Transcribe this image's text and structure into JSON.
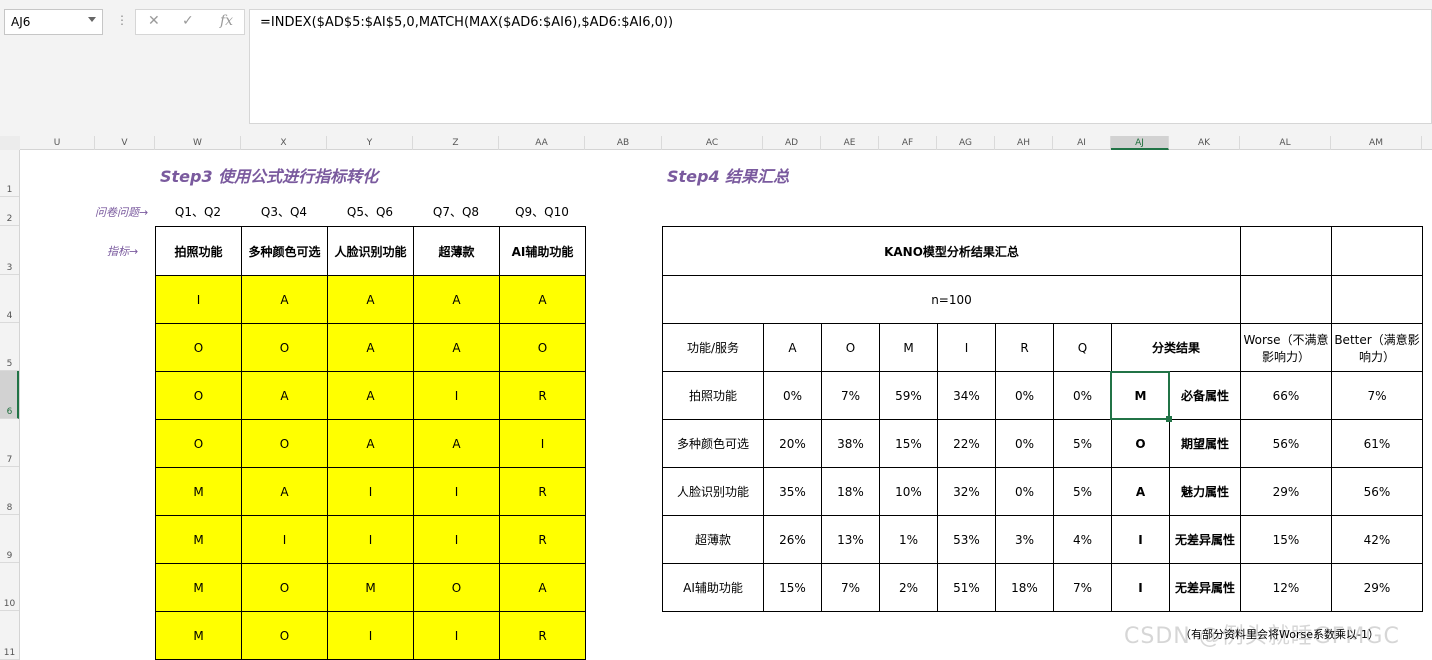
{
  "formula_bar": {
    "name_box": "AJ6",
    "formula": "=INDEX($AD$5:$AI$5,0,MATCH(MAX($AD6:$AI6),$AD6:$AI6,0))"
  },
  "columns": [
    "U",
    "V",
    "W",
    "X",
    "Y",
    "Z",
    "AA",
    "AB",
    "AC",
    "AD",
    "AE",
    "AF",
    "AG",
    "AH",
    "AI",
    "AJ",
    "AK",
    "AL",
    "AM"
  ],
  "rows": [
    "1",
    "2",
    "3",
    "4",
    "5",
    "6",
    "7",
    "8",
    "9",
    "10",
    "11"
  ],
  "step3": {
    "title": "Step3 使用公式进行指标转化",
    "question_label": "问卷问题→",
    "indicator_label": "指标→",
    "questions": [
      "Q1、Q2",
      "Q3、Q4",
      "Q5、Q6",
      "Q7、Q8",
      "Q9、Q10"
    ],
    "headers": [
      "拍照功能",
      "多种颜色可选",
      "人脸识别功能",
      "超薄款",
      "AI辅助功能"
    ],
    "rows": [
      [
        "I",
        "A",
        "A",
        "A",
        "A"
      ],
      [
        "O",
        "O",
        "A",
        "A",
        "O"
      ],
      [
        "O",
        "A",
        "A",
        "I",
        "R"
      ],
      [
        "O",
        "O",
        "A",
        "A",
        "I"
      ],
      [
        "M",
        "A",
        "I",
        "I",
        "R"
      ],
      [
        "M",
        "I",
        "I",
        "I",
        "R"
      ],
      [
        "M",
        "O",
        "M",
        "O",
        "A"
      ],
      [
        "M",
        "O",
        "I",
        "I",
        "R"
      ]
    ]
  },
  "step4": {
    "title": "Step4 结果汇总",
    "summary_title": "KANO模型分析结果汇总",
    "n_label": "n=100",
    "headers": {
      "feature": "功能/服务",
      "A": "A",
      "O": "O",
      "M": "M",
      "I": "I",
      "R": "R",
      "Q": "Q",
      "result": "分类结果",
      "worse": "Worse（不满意影响力）",
      "better": "Better（满意影响力）"
    },
    "rows": [
      {
        "feature": "拍照功能",
        "A": "0%",
        "O": "7%",
        "M": "59%",
        "I": "34%",
        "R": "0%",
        "Q": "0%",
        "code": "M",
        "attr": "必备属性",
        "worse": "66%",
        "better": "7%"
      },
      {
        "feature": "多种颜色可选",
        "A": "20%",
        "O": "38%",
        "M": "15%",
        "I": "22%",
        "R": "0%",
        "Q": "5%",
        "code": "O",
        "attr": "期望属性",
        "worse": "56%",
        "better": "61%"
      },
      {
        "feature": "人脸识别功能",
        "A": "35%",
        "O": "18%",
        "M": "10%",
        "I": "32%",
        "R": "0%",
        "Q": "5%",
        "code": "A",
        "attr": "魅力属性",
        "worse": "29%",
        "better": "56%"
      },
      {
        "feature": "超薄款",
        "A": "26%",
        "O": "13%",
        "M": "1%",
        "I": "53%",
        "R": "3%",
        "Q": "4%",
        "code": "I",
        "attr": "无差异属性",
        "worse": "15%",
        "better": "42%"
      },
      {
        "feature": "AI辅助功能",
        "A": "15%",
        "O": "7%",
        "M": "2%",
        "I": "51%",
        "R": "18%",
        "Q": "7%",
        "code": "I",
        "attr": "无差异属性",
        "worse": "12%",
        "better": "29%"
      }
    ],
    "note": "（有部分资料里会将Worse系数乘以-1）"
  },
  "watermark": "CSDN @例头就睡GFMGC",
  "colors": {
    "highlight": "#ffff00",
    "title": "#7a5a9e",
    "selection": "#217346"
  }
}
